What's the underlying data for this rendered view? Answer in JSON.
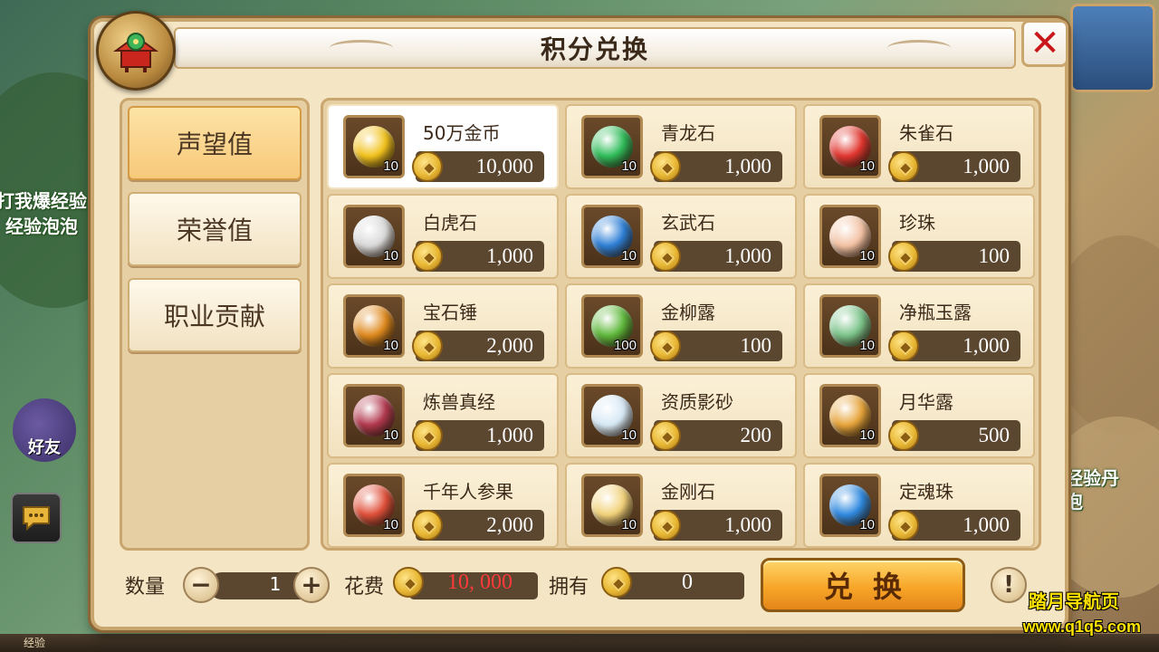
{
  "window": {
    "title": "积分兑换",
    "close_label": "✕"
  },
  "background": {
    "left_text_1": "打我爆经验",
    "left_text_2": "经验泡泡",
    "right_text_1": "经验丹",
    "right_text_2": "泡",
    "friend_label": "好友",
    "bottom_label": "经验"
  },
  "sidebar": {
    "tabs": [
      {
        "label": "声望值",
        "active": true
      },
      {
        "label": "荣誉值",
        "active": false
      },
      {
        "label": "职业贡献",
        "active": false
      }
    ]
  },
  "items": [
    {
      "name": "50万金币",
      "qty": "10",
      "price": "10,000",
      "selected": true,
      "icon": "gold-coin-icon",
      "color": "#f2c21c"
    },
    {
      "name": "青龙石",
      "qty": "10",
      "price": "1,000",
      "icon": "azure-dragon-stone-icon",
      "color": "#2fbd5a"
    },
    {
      "name": "朱雀石",
      "qty": "10",
      "price": "1,000",
      "icon": "vermilion-bird-stone-icon",
      "color": "#e2362f"
    },
    {
      "name": "白虎石",
      "qty": "10",
      "price": "1,000",
      "icon": "white-tiger-stone-icon",
      "color": "#d9d9d9"
    },
    {
      "name": "玄武石",
      "qty": "10",
      "price": "1,000",
      "icon": "black-tortoise-stone-icon",
      "color": "#2d7fd6"
    },
    {
      "name": "珍珠",
      "qty": "10",
      "price": "100",
      "icon": "pearl-icon",
      "color": "#f3c2a4"
    },
    {
      "name": "宝石锤",
      "qty": "10",
      "price": "2,000",
      "icon": "gem-hammer-icon",
      "color": "#e08a1e"
    },
    {
      "name": "金柳露",
      "qty": "100",
      "price": "100",
      "icon": "golden-willow-dew-icon",
      "color": "#5fb93c"
    },
    {
      "name": "净瓶玉露",
      "qty": "10",
      "price": "1,000",
      "icon": "vase-jade-dew-icon",
      "color": "#7bc48a"
    },
    {
      "name": "炼兽真经",
      "qty": "10",
      "price": "1,000",
      "icon": "beast-scripture-icon",
      "color": "#b2384e"
    },
    {
      "name": "资质影砂",
      "qty": "10",
      "price": "200",
      "icon": "aptitude-sand-orb-icon",
      "color": "#d6e8f5"
    },
    {
      "name": "月华露",
      "qty": "10",
      "price": "500",
      "icon": "moon-dew-gourd-icon",
      "color": "#e7a43a"
    },
    {
      "name": "千年人参果",
      "qty": "10",
      "price": "2,000",
      "icon": "ginseng-fruit-icon",
      "color": "#e0503a"
    },
    {
      "name": "金刚石",
      "qty": "10",
      "price": "1,000",
      "icon": "diamond-cheese-stone-icon",
      "color": "#f2d27a"
    },
    {
      "name": "定魂珠",
      "qty": "10",
      "price": "1,000",
      "icon": "soul-pearl-icon",
      "color": "#2f8ae0"
    }
  ],
  "footer": {
    "quantity_label": "数量",
    "quantity_value": "1",
    "minus_label": "−",
    "plus_label": "+",
    "cost_label": "花费",
    "cost_value": "10, 000",
    "own_label": "拥有",
    "own_value": "0",
    "exchange_label": "兑换",
    "info_label": "!"
  },
  "watermark": {
    "line1": "踏月导航页",
    "line2": "www.q1q5.com"
  }
}
